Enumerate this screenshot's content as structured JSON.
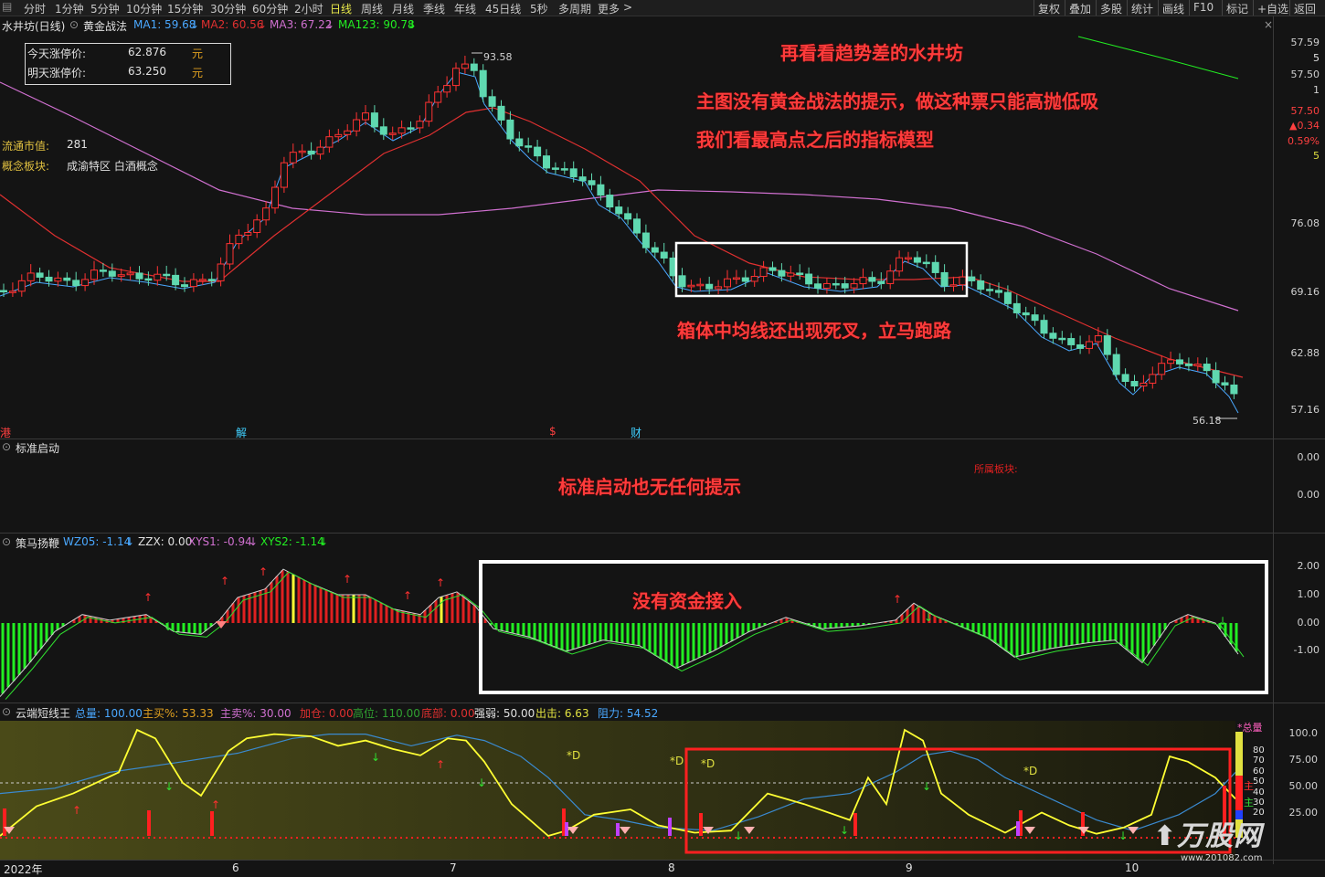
{
  "toolbar": {
    "periods": [
      "分时",
      "1分钟",
      "5分钟",
      "10分钟",
      "15分钟",
      "30分钟",
      "60分钟",
      "2小时",
      "日线",
      "周线",
      "月线",
      "季线",
      "年线",
      "45日线",
      "5秒",
      "多周期",
      "更多"
    ],
    "active_period": "日线",
    "more_arrow": ">",
    "right_items": [
      "复权",
      "叠加",
      "多股",
      "统计",
      "画线",
      "F10",
      "标记",
      "+自选",
      "返回"
    ]
  },
  "main": {
    "stock_title": "水井坊(日线)",
    "indicator_name": "黄金战法",
    "ma1": "MA1: 59.68",
    "ma2": "MA2: 60.56",
    "ma3": "MA3: 67.22",
    "ma123": "MA123: 90.78",
    "limit_today_label": "今天涨停价:",
    "limit_today_value": "62.876",
    "limit_today_unit": "元",
    "limit_tomorrow_label": "明天涨停价:",
    "limit_tomorrow_value": "63.250",
    "limit_tomorrow_unit": "元",
    "float_cap_label": "流通市值:",
    "float_cap_value": "281",
    "concept_label": "概念板块:",
    "concept_value": "成渝特区 白酒概念",
    "high_label": "93.58",
    "low_label": "56.18",
    "axis": [
      "76.08",
      "69.16",
      "62.88",
      "57.16"
    ],
    "right_info": [
      "57.59",
      "5",
      "57.50",
      "1",
      "57.50",
      "▲0.34",
      "0.59%",
      "5"
    ],
    "markers": {
      "gang": "港",
      "jie": "解",
      "s": "$",
      "cai": "财"
    },
    "annotations": {
      "a1": "再看看趋势差的水井坊",
      "a2": "主图没有黄金战法的提示，做这种票只能高抛低吸",
      "a3": "我们看最高点之后的指标模型",
      "a4": "箱体中均线还出现死叉，立马跑路"
    }
  },
  "panel2": {
    "title": "标准启动",
    "annotation": "标准启动也无任何提示",
    "sector_label": "所属板块:",
    "axis": [
      "0.00",
      "0.00"
    ]
  },
  "panel3": {
    "title": "策马扬鞭",
    "wz05": "WZ05: -1.14",
    "zzx": "ZZX: 0.00",
    "xys1": "XYS1: -0.94",
    "xys2": "XYS2: -1.14",
    "annotation": "没有资金接入",
    "axis": [
      "2.00",
      "1.00",
      "0.00",
      "-1.00"
    ]
  },
  "panel4": {
    "title": "云端短线王",
    "zongliang": "总量: 100.00",
    "zhumai": "主买%: 53.33",
    "zhumaic": "主卖%: 30.00",
    "jiacang": "加仓: 0.00",
    "gaowei": "高位: 110.00",
    "dibu": "底部: 0.00",
    "qiangruo": "强弱: 50.00",
    "chuji": "出击: 6.63",
    "zuli": "阻力: 54.52",
    "d_marks": [
      "*D",
      "*D",
      "*D",
      "*D"
    ],
    "axis": [
      "100.0",
      "75.00",
      "50.00",
      "25.00"
    ],
    "legend_title": "*总量",
    "legend_ticks": [
      "80",
      "70",
      "60",
      "50",
      "40",
      "30",
      "20"
    ],
    "legend_side": [
      "主",
      "主"
    ]
  },
  "xaxis": {
    "year": "2022年",
    "months": [
      "6",
      "7",
      "8",
      "9",
      "10"
    ]
  },
  "watermark": {
    "text": "万股网",
    "url": "www.201082.com"
  },
  "colors": {
    "up": "#ff3232",
    "down": "#54ffff",
    "candle_down": "#5fd8b0",
    "ma1": "#4aa8ff",
    "ma2": "#e03030",
    "ma3": "#d070d0",
    "green_bar": "#22ee22",
    "red_bar": "#e02020",
    "yellow": "#ffff33",
    "annotation": "#ff3b3b"
  }
}
